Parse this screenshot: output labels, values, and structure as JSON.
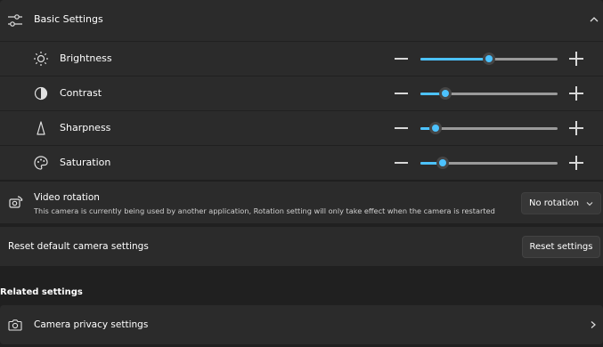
{
  "basic_settings": {
    "title": "Basic Settings",
    "icon": "sliders-icon",
    "expanded": true
  },
  "sliders": [
    {
      "id": "brightness",
      "label": "Brightness",
      "icon": "sun-icon",
      "value_percent": 50
    },
    {
      "id": "contrast",
      "label": "Contrast",
      "icon": "contrast-icon",
      "value_percent": 18
    },
    {
      "id": "sharpness",
      "label": "Sharpness",
      "icon": "sharpness-icon",
      "value_percent": 11
    },
    {
      "id": "saturation",
      "label": "Saturation",
      "icon": "palette-icon",
      "value_percent": 16
    }
  ],
  "video_rotation": {
    "title": "Video rotation",
    "subtitle": "This camera is currently being used by another application, Rotation setting will only take effect when the camera is restarted",
    "selected": "No rotation",
    "icon": "rotate-camera-icon"
  },
  "reset": {
    "label": "Reset default camera settings",
    "button": "Reset settings"
  },
  "related": {
    "heading": "Related settings",
    "privacy_label": "Camera privacy settings",
    "privacy_icon": "camera-icon"
  },
  "colors": {
    "accent": "#4cc2ff",
    "background": "#202020",
    "card": "#2b2b2b"
  }
}
